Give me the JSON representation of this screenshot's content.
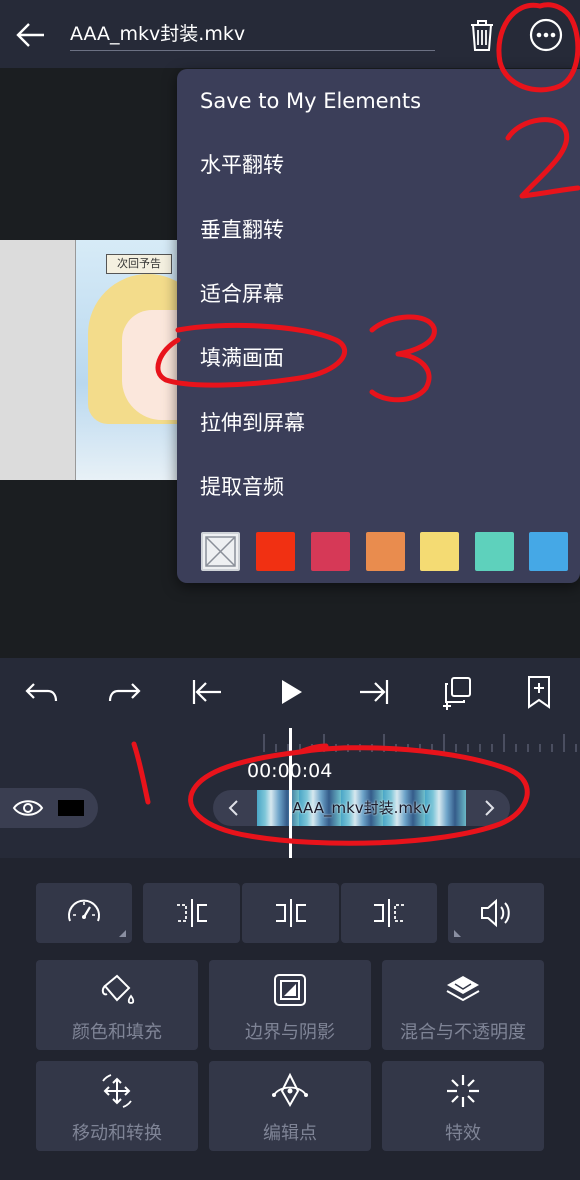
{
  "header": {
    "title": "AAA_mkv封装.mkv",
    "back_icon": "arrow-left-icon",
    "trash_icon": "trash-icon",
    "more_icon": "more-horizontal-icon"
  },
  "preview": {
    "thumbnail_caption": "次回予告"
  },
  "menu": {
    "items": [
      "Save to My Elements",
      "水平翻转",
      "垂直翻转",
      "适合屏幕",
      "填满画面",
      "拉伸到屏幕",
      "提取音频"
    ],
    "swatches": [
      "none",
      "#f13012",
      "#d63957",
      "#e98c4e",
      "#f4db73",
      "#5ed1bc",
      "#45a8e6"
    ]
  },
  "toolbar": {
    "icons": [
      "undo-icon",
      "redo-icon",
      "skip-to-start-icon",
      "play-icon",
      "skip-to-end-icon",
      "copy-icon",
      "bookmark-add-icon"
    ]
  },
  "timeline": {
    "timecode": "00:00:04",
    "clip_name": "AAA_mkv封装.mkv"
  },
  "panel": {
    "row1": [
      "speed-icon",
      "split-left-icon",
      "split-icon",
      "split-right-icon",
      "volume-icon"
    ],
    "row2": [
      {
        "label": "颜色和填充",
        "icon": "paint-bucket-icon"
      },
      {
        "label": "边界与阴影",
        "icon": "border-shadow-icon"
      },
      {
        "label": "混合与不透明度",
        "icon": "layers-icon"
      }
    ],
    "row3": [
      {
        "label": "移动和转换",
        "icon": "move-rotate-icon"
      },
      {
        "label": "编辑点",
        "icon": "pen-tool-icon"
      },
      {
        "label": "特效",
        "icon": "sparkle-icon"
      }
    ]
  },
  "annotations": [
    "1",
    "2",
    "3"
  ],
  "colors": {
    "header_bg": "#262a38",
    "menu_bg": "#3b3e59",
    "panel_bg": "#21242f",
    "tile_bg": "#333748",
    "annotation": "#e8131b"
  }
}
